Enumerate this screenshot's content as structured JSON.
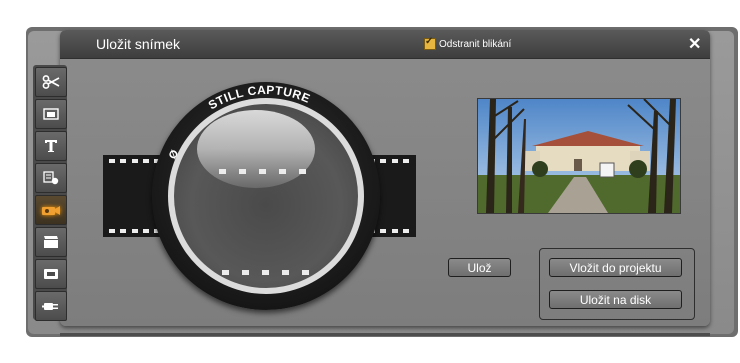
{
  "window": {
    "title": "Uložit snímek",
    "flicker_label": "Odstranit blikání",
    "flicker_checked": true,
    "close_symbol": "✕"
  },
  "lens": {
    "ring_text": "STILL CAPTURE",
    "symbol": "Ø"
  },
  "toolbar": {
    "tools": [
      {
        "name": "scissors-icon",
        "active": false
      },
      {
        "name": "overlay-icon",
        "active": false
      },
      {
        "name": "title-icon",
        "active": false
      },
      {
        "name": "sound-effects-icon",
        "active": false
      },
      {
        "name": "camera-icon",
        "active": true
      },
      {
        "name": "clapperboard-icon",
        "active": false
      },
      {
        "name": "screen-icon",
        "active": false
      },
      {
        "name": "plug-icon",
        "active": false
      }
    ]
  },
  "buttons": {
    "save": "Ulož",
    "insert_project": "Vložit do projektu",
    "save_disk": "Uložit na disk"
  },
  "colors": {
    "accent": "#e7b641",
    "panel": "#808080",
    "titlebar": "#4a4a4a"
  }
}
